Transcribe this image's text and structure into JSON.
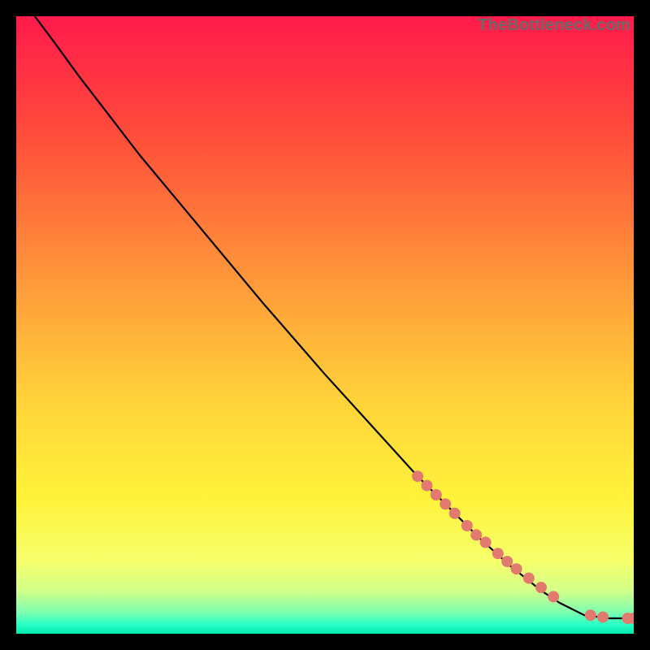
{
  "watermark": "TheBottleneck.com",
  "chart_data": {
    "type": "line",
    "title": "",
    "xlabel": "",
    "ylabel": "",
    "xlim": [
      0,
      100
    ],
    "ylim": [
      0,
      100
    ],
    "grid": false,
    "legend": false,
    "gradient_stops": [
      {
        "offset": 0.0,
        "color": "#ff1a4b"
      },
      {
        "offset": 0.2,
        "color": "#ff4f3a"
      },
      {
        "offset": 0.42,
        "color": "#ff963a"
      },
      {
        "offset": 0.62,
        "color": "#ffd23a"
      },
      {
        "offset": 0.78,
        "color": "#fff23a"
      },
      {
        "offset": 0.88,
        "color": "#f7ff6a"
      },
      {
        "offset": 0.93,
        "color": "#d4ff8a"
      },
      {
        "offset": 0.965,
        "color": "#7dffb0"
      },
      {
        "offset": 0.985,
        "color": "#2affc5"
      },
      {
        "offset": 1.0,
        "color": "#00e8b0"
      }
    ],
    "series": [
      {
        "name": "curve",
        "type": "line",
        "color": "#000000",
        "x": [
          3.0,
          6.0,
          10.0,
          15.0,
          20.0,
          30.0,
          40.0,
          50.0,
          60.0,
          65.0,
          70.0,
          75.0,
          80.0,
          85.0,
          88.0,
          92.0,
          96.0,
          100.0
        ],
        "y": [
          100.0,
          96.0,
          90.5,
          84.0,
          77.5,
          65.5,
          53.5,
          42.0,
          31.0,
          25.5,
          20.5,
          15.5,
          11.0,
          7.0,
          5.0,
          3.0,
          2.5,
          2.5
        ]
      },
      {
        "name": "markers",
        "type": "scatter",
        "color": "#e27a70",
        "radius": 7,
        "x": [
          65.0,
          66.5,
          68.0,
          69.5,
          71.0,
          73.0,
          74.5,
          76.0,
          78.0,
          79.5,
          81.0,
          83.0,
          85.0,
          87.0,
          93.0,
          95.0,
          99.0,
          100.0
        ],
        "y": [
          25.5,
          24.0,
          22.5,
          21.0,
          19.5,
          17.5,
          16.0,
          14.8,
          13.0,
          11.7,
          10.5,
          9.0,
          7.5,
          6.0,
          3.0,
          2.7,
          2.5,
          2.5
        ]
      }
    ]
  }
}
